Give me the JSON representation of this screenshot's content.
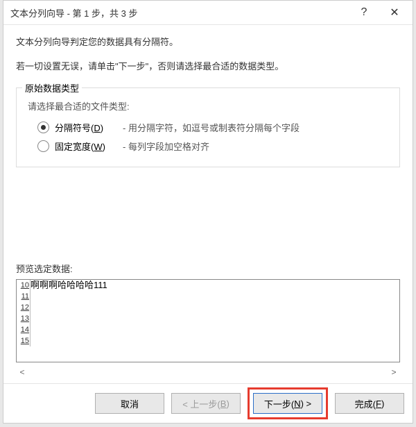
{
  "titlebar": {
    "title": "文本分列向导 - 第 1 步，共 3 步",
    "help": "?",
    "close": "✕"
  },
  "intro": {
    "line1": "文本分列向导判定您的数据具有分隔符。",
    "line2": "若一切设置无误，请单击\"下一步\"，否则请选择最合适的数据类型。"
  },
  "fieldset": {
    "legend": "原始数据类型",
    "hint": "请选择最合适的文件类型:",
    "opt1_label_pre": "分隔符号(",
    "opt1_label_key": "D",
    "opt1_label_post": ")",
    "opt1_desc": "- 用分隔字符，如逗号或制表符分隔每个字段",
    "opt2_label_pre": "固定宽度(",
    "opt2_label_key": "W",
    "opt2_label_post": ")",
    "opt2_desc": "- 每列字段加空格对齐"
  },
  "preview": {
    "label": "预览选定数据:",
    "rows": [
      {
        "n": "10",
        "t": "啊啊啊哈哈哈哈111"
      },
      {
        "n": "11",
        "t": ""
      },
      {
        "n": "12",
        "t": ""
      },
      {
        "n": "13",
        "t": ""
      },
      {
        "n": "14",
        "t": ""
      },
      {
        "n": "15",
        "t": ""
      }
    ]
  },
  "footer": {
    "cancel": "取消",
    "back_pre": "< 上一步(",
    "back_key": "B",
    "back_post": ")",
    "next_pre": "下一步(",
    "next_key": "N",
    "next_post": ") >",
    "finish_pre": "完成(",
    "finish_key": "F",
    "finish_post": ")"
  }
}
